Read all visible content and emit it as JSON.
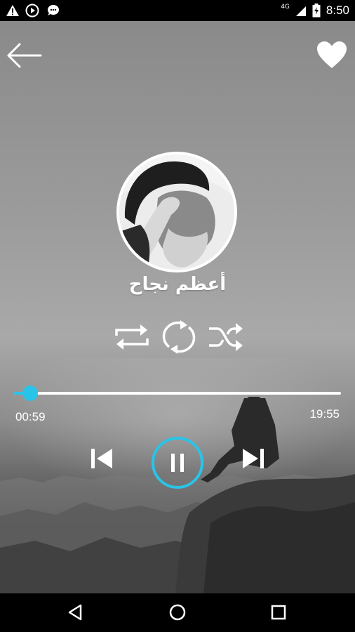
{
  "status_bar": {
    "time": "8:50",
    "network": "4G",
    "left_icons": [
      "warning-icon",
      "play-circle-icon",
      "chat-bubble-icon"
    ],
    "right_icons": [
      "signal-icon",
      "battery-icon"
    ]
  },
  "header": {
    "back_icon": "arrow-left-icon",
    "favorite_icon": "heart-icon"
  },
  "track": {
    "title": "أعظم نجاح"
  },
  "modes": [
    "repeat-all-icon",
    "repeat-one-icon",
    "shuffle-icon"
  ],
  "player": {
    "current_time": "00:59",
    "total_time": "19:55",
    "progress": 0.05,
    "state": "playing"
  },
  "colors": {
    "accent": "#29c4e8",
    "status_bar": "#000000",
    "nav_bar": "#000000"
  },
  "nav": [
    "back-triangle-icon",
    "home-circle-icon",
    "recents-square-icon"
  ]
}
